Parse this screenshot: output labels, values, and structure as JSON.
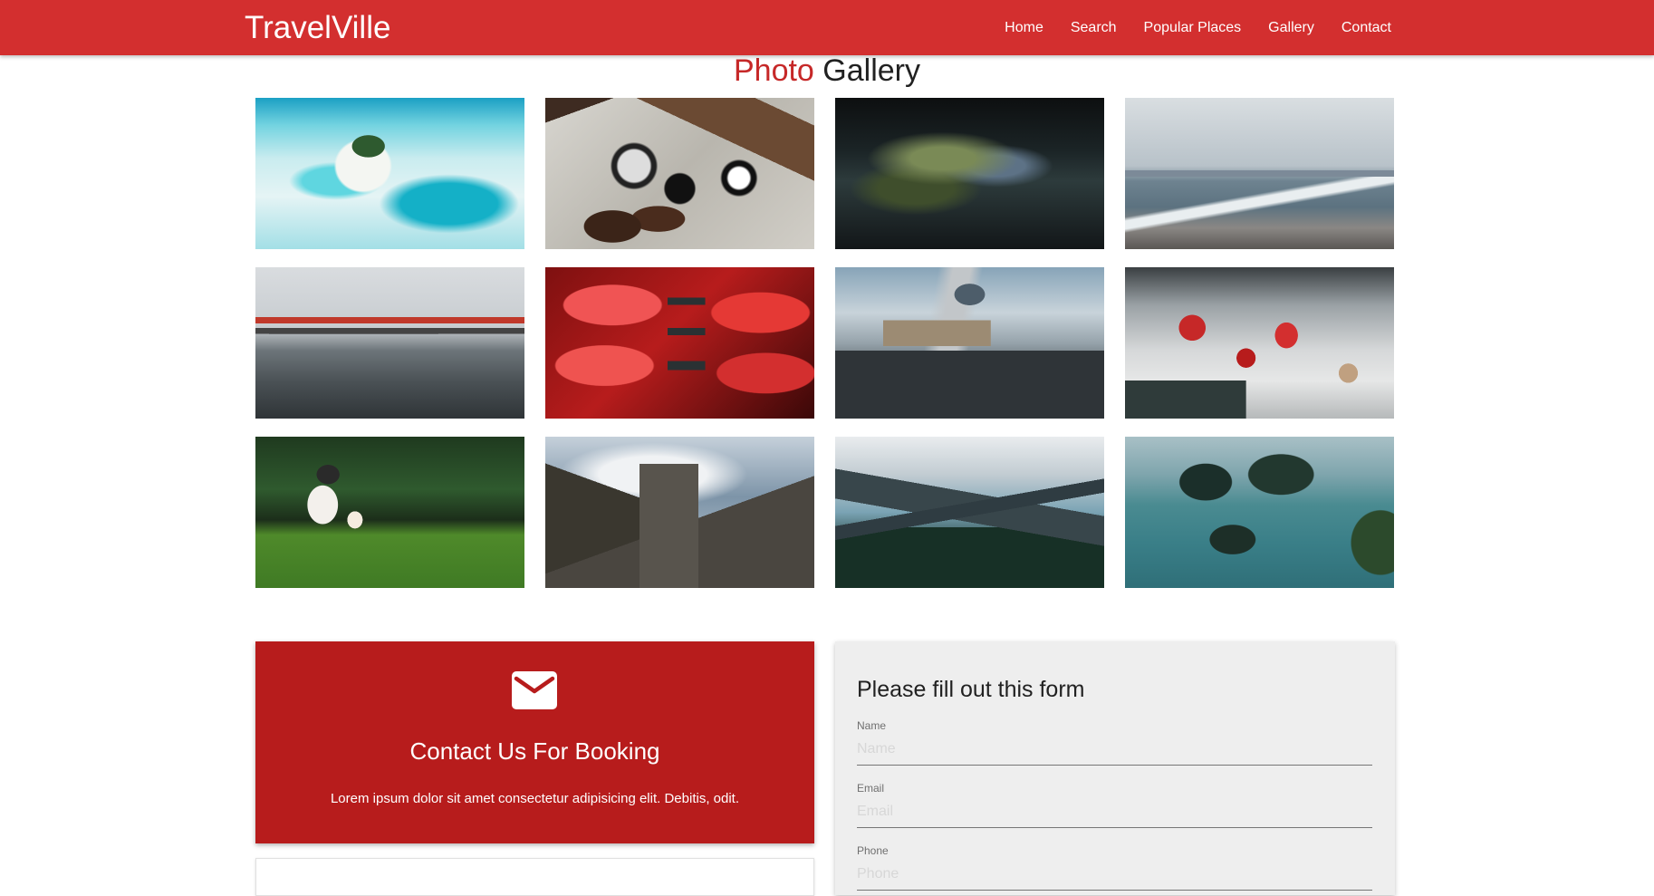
{
  "brand": "TravelVille",
  "nav": [
    "Home",
    "Search",
    "Popular Places",
    "Gallery",
    "Contact"
  ],
  "gallery": {
    "title_accent": "Photo",
    "title_rest": "Gallery"
  },
  "contact": {
    "icon": "mail-icon",
    "title": "Contact Us For Booking",
    "description": "Lorem ipsum dolor sit amet consectetur adipisicing elit. Debitis, odit."
  },
  "form": {
    "title": "Please fill out this form",
    "fields": [
      {
        "label": "Name",
        "placeholder": "Name"
      },
      {
        "label": "Email",
        "placeholder": "Email"
      },
      {
        "label": "Phone",
        "placeholder": "Phone"
      }
    ]
  },
  "colors": {
    "primary": "#d32f2f",
    "card": "#b71c1c",
    "accent_text": "#c62828"
  }
}
